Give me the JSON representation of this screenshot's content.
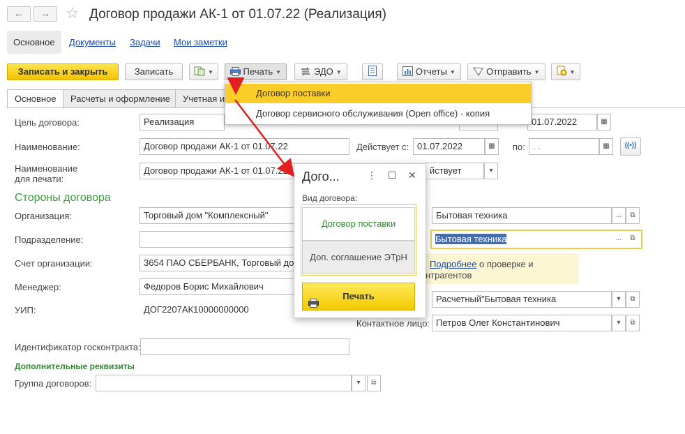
{
  "window": {
    "title": "Договор продажи АК-1 от 01.07.22 (Реализация)",
    "back_glyph": "←",
    "forward_glyph": "→",
    "star_glyph": "☆"
  },
  "sections": [
    {
      "label": "Основное"
    },
    {
      "label": "Документы"
    },
    {
      "label": "Задачи"
    },
    {
      "label": "Мои заметки"
    }
  ],
  "toolbar": {
    "save_close": "Записать и закрыть",
    "save": "Записать",
    "print": "Печать",
    "edo": "ЭДО",
    "reports": "Отчеты",
    "send": "Отправить"
  },
  "print_menu": {
    "items": [
      "Договор поставки",
      "Договор сервисного обслуживания (Open office) - копия"
    ]
  },
  "form_tabs": [
    {
      "label": "Основное"
    },
    {
      "label": "Расчеты и оформление"
    },
    {
      "label": "Учетная и"
    }
  ],
  "form": {
    "goal_label": "Цель договора:",
    "goal_value": "Реализация",
    "date_value": "01.07.2022",
    "name_label": "Наименование:",
    "name_value": "Договор продажи АК-1 от 01.07.22",
    "valid_from_label": "Действует с:",
    "valid_from_value": "01.07.2022",
    "valid_to_label": "по:",
    "valid_to_value": ". .",
    "print_name_label_1": "Наименование",
    "print_name_label_2": "для печати:",
    "print_name_value": "Договор продажи АК-1 от 01.07.22",
    "status_value": "йствует",
    "parties_heading": "Стороны договора",
    "org_label": "Организация:",
    "org_value": "Торговый дом \"Комплексный\"",
    "dept_label": "Подразделение:",
    "dept_value": "",
    "account_label": "Счет организации:",
    "account_value": "3654 ПАО СБЕРБАНК, Торговый до",
    "manager_label": "Менеджер:",
    "manager_value": "Федоров Борис Михайлович",
    "uip_label": "УИП:",
    "uip_value": "ДОГ2207АК10000000000",
    "gov_label": "Идентификатор госконтракта:",
    "gov_value": "",
    "extra_heading": "Дополнительные реквизиты",
    "group_label": "Группа договоров:",
    "group_value": "",
    "counterparty_value": "Бытовая техника",
    "counterparty2_value": "Бытовая техника",
    "info_link": "Подробнее",
    "info_text_1": "о проверке и",
    "info_text_2": "нтрагентов",
    "settlement_value": "Расчетный\"Бытовая техника",
    "contact_label": "Контактное лицо:",
    "contact_value": "Петров Олег Константинович",
    "ellipsis": "...",
    "open_glyph": "⧉",
    "dropdown_glyph": "▾",
    "calendar_glyph": "▦",
    "signal_glyph": "((•))"
  },
  "dialog": {
    "title": "Дого...",
    "kind_label": "Вид договора:",
    "option_active": "Договор поставки",
    "option_other": "Доп. соглашение ЭТрН",
    "print_button": "Печать",
    "menu_glyph": "⋮",
    "max_glyph": "☐",
    "close_glyph": "✕"
  },
  "colors": {
    "accent_yellow": "#f2c400",
    "highlight": "#fbcd2a",
    "link_blue": "#1a4aa7",
    "green": "#3a9a3a",
    "arrow_red": "#e02020"
  }
}
